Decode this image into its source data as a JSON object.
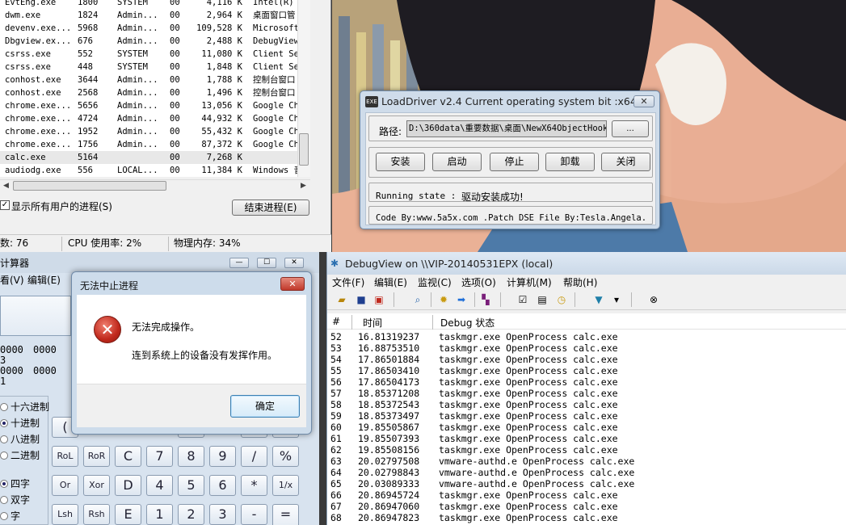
{
  "taskmgr": {
    "processes": [
      {
        "name": "EvtEng.exe",
        "pid": "1800",
        "user": "SYSTEM",
        "cpu": "00",
        "mem": "4,116 K",
        "desc": "Intel(R)"
      },
      {
        "name": "dwm.exe",
        "pid": "1824",
        "user": "Admin...",
        "cpu": "00",
        "mem": "2,964 K",
        "desc": "桌面窗口管"
      },
      {
        "name": "devenv.exe...",
        "pid": "5968",
        "user": "Admin...",
        "cpu": "00",
        "mem": "109,528 K",
        "desc": "Microsoft"
      },
      {
        "name": "Dbgview.ex...",
        "pid": "676",
        "user": "Admin...",
        "cpu": "00",
        "mem": "2,488 K",
        "desc": "DebugView"
      },
      {
        "name": "csrss.exe",
        "pid": "552",
        "user": "SYSTEM",
        "cpu": "00",
        "mem": "11,080 K",
        "desc": "Client Se"
      },
      {
        "name": "csrss.exe",
        "pid": "448",
        "user": "SYSTEM",
        "cpu": "00",
        "mem": "1,848 K",
        "desc": "Client Se"
      },
      {
        "name": "conhost.exe",
        "pid": "3644",
        "user": "Admin...",
        "cpu": "00",
        "mem": "1,788 K",
        "desc": "控制台窗口"
      },
      {
        "name": "conhost.exe",
        "pid": "2568",
        "user": "Admin...",
        "cpu": "00",
        "mem": "1,496 K",
        "desc": "控制台窗口"
      },
      {
        "name": "chrome.exe...",
        "pid": "5656",
        "user": "Admin...",
        "cpu": "00",
        "mem": "13,056 K",
        "desc": "Google Ch"
      },
      {
        "name": "chrome.exe...",
        "pid": "4724",
        "user": "Admin...",
        "cpu": "00",
        "mem": "44,932 K",
        "desc": "Google Ch"
      },
      {
        "name": "chrome.exe...",
        "pid": "1952",
        "user": "Admin...",
        "cpu": "00",
        "mem": "55,432 K",
        "desc": "Google Ch"
      },
      {
        "name": "chrome.exe...",
        "pid": "1756",
        "user": "Admin...",
        "cpu": "00",
        "mem": "87,372 K",
        "desc": "Google Ch"
      },
      {
        "name": "calc.exe",
        "pid": "5164",
        "user": "",
        "cpu": "00",
        "mem": "7,268 K",
        "desc": ""
      },
      {
        "name": "audiodg.exe",
        "pid": "556",
        "user": "LOCAL...",
        "cpu": "00",
        "mem": "11,384 K",
        "desc": "Windows 音"
      }
    ],
    "show_all_label": "显示所有用户的进程(S)",
    "end_process_label": "结束进程(E)",
    "status": {
      "processes": "数: 76",
      "cpu": "CPU 使用率: 2%",
      "memory": "物理内存: 34%"
    }
  },
  "loaddriver": {
    "title": "LoadDriver v2.4 Current operating system bit :x64",
    "icon_text": "EXE",
    "close_label": "✕",
    "path_label": "路径:",
    "path_value": "D:\\360data\\重要数据\\桌面\\NewX64ObjectHook",
    "browse_label": "...",
    "buttons": [
      "安装",
      "启动",
      "停止",
      "卸载",
      "关闭"
    ],
    "state_label": "Running state :",
    "state_value": "驱动安装成功!",
    "credits": "Code By:www.5a5x.com .Patch DSE File By:Tesla.Angela."
  },
  "calc": {
    "title": "计算器",
    "window_buttons": [
      "—",
      "☐",
      "✕"
    ],
    "menu": [
      "看(V)",
      "编辑(E)"
    ],
    "bits_rows": [
      {
        "a": "0000",
        "b": "0000",
        "num": "3"
      },
      {
        "a": "0000",
        "b": "0000",
        "num": "1"
      }
    ],
    "radios": [
      "十六进制",
      "十进制",
      "八进制",
      "二进制"
    ],
    "word_radios": [
      "四字",
      "双字",
      "字"
    ],
    "keys": [
      [
        "(",
        ")",
        "%",
        "√",
        "",
        ""
      ],
      [
        "RoL",
        "RoR",
        "C",
        "7",
        "8",
        "9",
        "/",
        "%"
      ],
      [
        "Or",
        "Xor",
        "D",
        "4",
        "5",
        "6",
        "*",
        "1/x"
      ],
      [
        "Lsh",
        "Rsh",
        "E",
        "1",
        "2",
        "3",
        "-",
        "="
      ]
    ]
  },
  "error_dialog": {
    "title": "无法中止进程",
    "close_label": "✕",
    "icon_glyph": "✕",
    "message1": "无法完成操作。",
    "message2": "连到系统上的设备没有发挥作用。",
    "ok_label": "确定"
  },
  "debugview": {
    "title": "DebugView on \\\\VIP-20140531EPX (local)",
    "menu": [
      "文件(F)",
      "编辑(E)",
      "监视(C)",
      "选项(O)",
      "计算机(M)",
      "帮助(H)"
    ],
    "columns": [
      "#",
      "时间",
      "Debug 状态"
    ],
    "log": [
      {
        "n": "52",
        "t": "16.81319237",
        "m": "taskmgr.exe OpenProcess calc.exe"
      },
      {
        "n": "53",
        "t": "16.88753510",
        "m": "taskmgr.exe OpenProcess calc.exe"
      },
      {
        "n": "54",
        "t": "17.86501884",
        "m": "taskmgr.exe OpenProcess calc.exe"
      },
      {
        "n": "55",
        "t": "17.86503410",
        "m": "taskmgr.exe OpenProcess calc.exe"
      },
      {
        "n": "56",
        "t": "17.86504173",
        "m": "taskmgr.exe OpenProcess calc.exe"
      },
      {
        "n": "57",
        "t": "18.85371208",
        "m": "taskmgr.exe OpenProcess calc.exe"
      },
      {
        "n": "58",
        "t": "18.85372543",
        "m": "taskmgr.exe OpenProcess calc.exe"
      },
      {
        "n": "59",
        "t": "18.85373497",
        "m": "taskmgr.exe OpenProcess calc.exe"
      },
      {
        "n": "60",
        "t": "19.85505867",
        "m": "taskmgr.exe OpenProcess calc.exe"
      },
      {
        "n": "61",
        "t": "19.85507393",
        "m": "taskmgr.exe OpenProcess calc.exe"
      },
      {
        "n": "62",
        "t": "19.85508156",
        "m": "taskmgr.exe OpenProcess calc.exe"
      },
      {
        "n": "63",
        "t": "20.02797508",
        "m": "vmware-authd.e OpenProcess calc.exe"
      },
      {
        "n": "64",
        "t": "20.02798843",
        "m": "vmware-authd.e OpenProcess calc.exe"
      },
      {
        "n": "65",
        "t": "20.03089333",
        "m": "vmware-authd.e OpenProcess calc.exe"
      },
      {
        "n": "66",
        "t": "20.86945724",
        "m": "taskmgr.exe OpenProcess calc.exe"
      },
      {
        "n": "67",
        "t": "20.86947060",
        "m": "taskmgr.exe OpenProcess calc.exe"
      },
      {
        "n": "68",
        "t": "20.86947823",
        "m": "taskmgr.exe OpenProcess calc.exe"
      }
    ]
  },
  "colors": {
    "anime_skin": "#e9ae94",
    "error_red": "#c0281c",
    "window_frame": "#cfdcea"
  }
}
